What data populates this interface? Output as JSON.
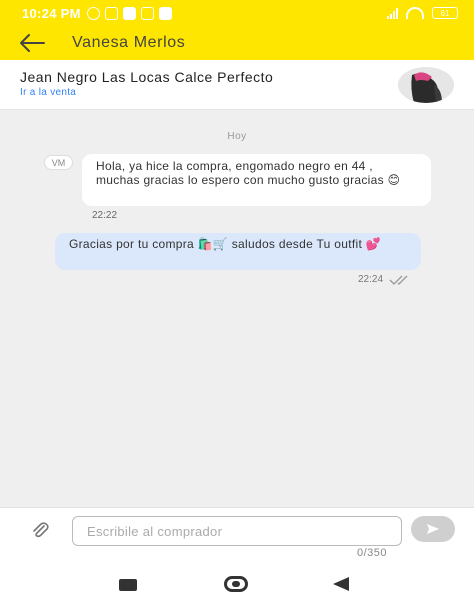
{
  "status_bar": {
    "time": "10:24 PM",
    "battery": "61"
  },
  "app_bar": {
    "contact_name": "Vanesa Merlos",
    "back_icon": "arrow-left-icon"
  },
  "product": {
    "title": "Jean Negro Las Locas Calce Perfecto",
    "link": "Ir a la venta"
  },
  "chat": {
    "day_label": "Hoy",
    "messages": [
      {
        "avatar": "VM",
        "text": "Hola, ya hice la compra, engomado negro en 44 , muchas gracias lo espero con mucho gusto gracias 😊",
        "time": "22:22"
      },
      {
        "text": "Gracias por tu compra 🛍️🛒 saludos desde Tu outfit 💕",
        "time": "22:24"
      }
    ]
  },
  "composer": {
    "placeholder": "Escribile al comprador",
    "counter": "0/350"
  },
  "colors": {
    "brand_yellow": "#ffe600",
    "link_blue": "#3483fa",
    "outgoing_bubble": "#dbe8fb"
  }
}
